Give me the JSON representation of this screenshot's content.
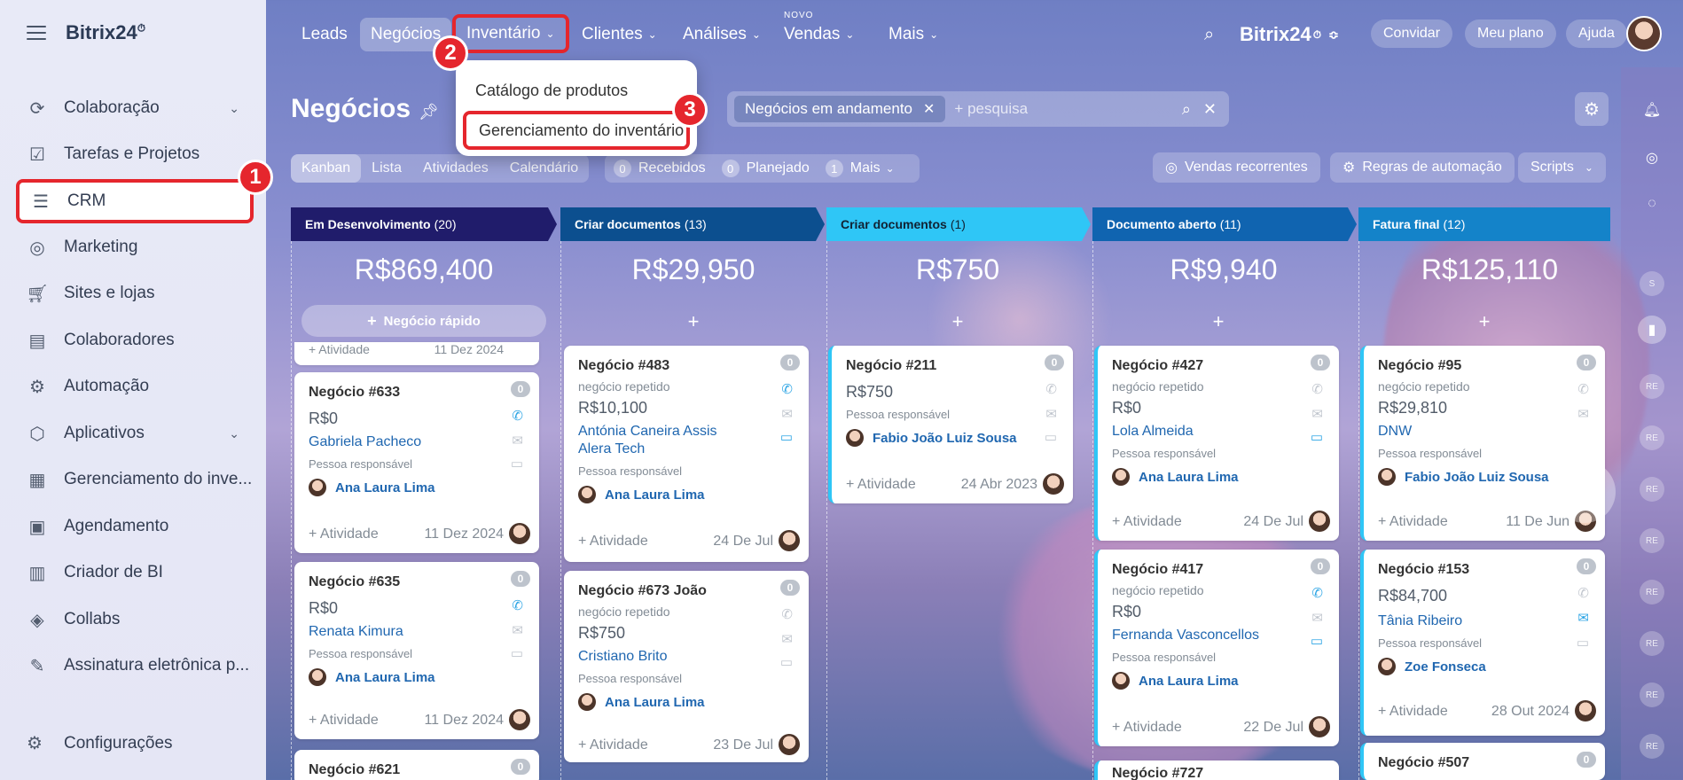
{
  "app": {
    "logo": "Bitrix24",
    "logo_mark": "⏱"
  },
  "sidebar": {
    "items": [
      {
        "label": "Colaboração",
        "icon": "collab-icon",
        "chevron": true
      },
      {
        "label": "Tarefas e Projetos",
        "icon": "tasks-icon"
      },
      {
        "label": "CRM",
        "icon": "crm-icon",
        "active": true
      },
      {
        "label": "Marketing",
        "icon": "marketing-icon"
      },
      {
        "label": "Sites e lojas",
        "icon": "cart-icon"
      },
      {
        "label": "Colaboradores",
        "icon": "employees-icon"
      },
      {
        "label": "Automação",
        "icon": "robot-icon"
      },
      {
        "label": "Aplicativos",
        "icon": "cube-icon",
        "chevron": true
      },
      {
        "label": "Gerenciamento do inve...",
        "icon": "inventory-icon"
      },
      {
        "label": "Agendamento",
        "icon": "calendar-icon"
      },
      {
        "label": "Criador de BI",
        "icon": "chart-icon"
      },
      {
        "label": "Collabs",
        "icon": "collabs-icon"
      },
      {
        "label": "Assinatura eletrônica p...",
        "icon": "sign-icon"
      }
    ],
    "config": "Configurações"
  },
  "topnav": {
    "items": [
      "Leads",
      "Negócios",
      "Inventário",
      "Clientes",
      "Análises",
      "Vendas",
      "Mais"
    ],
    "novo": "NOVO",
    "brand": "Bitrix24",
    "invite": "Convidar",
    "plan": "Meu plano",
    "help": "Ajuda"
  },
  "dropdown": {
    "item1": "Catálogo de produtos",
    "item2": "Gerenciamento do inventário"
  },
  "badges": [
    "1",
    "2",
    "3"
  ],
  "page": {
    "title": "Negócios",
    "filter_chip": "Negócios em andamento",
    "search_placeholder": "+ pesquisa"
  },
  "views": [
    "Kanban",
    "Lista",
    "Atividades",
    "Calendário"
  ],
  "counters": [
    {
      "n": "0",
      "label": "Recebidos"
    },
    {
      "n": "0",
      "label": "Planejado"
    },
    {
      "n": "1",
      "label": "Mais"
    }
  ],
  "tools": {
    "recurring": "Vendas recorrentes",
    "rules": "Regras de automação",
    "scripts": "Scripts"
  },
  "columns": [
    {
      "title": "Em Desenvolvimento",
      "count": "(20)",
      "sum": "R$869,400",
      "color": "#201c6b"
    },
    {
      "title": "Criar documentos",
      "count": "(13)",
      "sum": "R$29,950",
      "color": "#0c4f8f"
    },
    {
      "title": "Criar documentos",
      "count": "(1)",
      "sum": "R$750",
      "color": "#2fc6f6"
    },
    {
      "title": "Documento aberto",
      "count": "(11)",
      "sum": "R$9,940",
      "color": "#1064b0"
    },
    {
      "title": "Fatura final",
      "count": "(12)",
      "sum": "R$125,110",
      "color": "#1483c9"
    }
  ],
  "quick_deal": "Negócio rápido",
  "cards": {
    "c1_top": {
      "act": "+ Atividade",
      "date": "11 Dez 2024"
    },
    "c633": {
      "title": "Negócio #633",
      "count": "0",
      "amount": "R$0",
      "client": "Gabriela Pacheco",
      "resp": "Pessoa responsável",
      "person": "Ana Laura Lima",
      "act": "+ Atividade",
      "date": "11 Dez 2024"
    },
    "c635": {
      "title": "Negócio #635",
      "count": "0",
      "amount": "R$0",
      "client": "Renata Kimura",
      "resp": "Pessoa responsável",
      "person": "Ana Laura Lima",
      "act": "+ Atividade",
      "date": "11 Dez 2024"
    },
    "c621": {
      "title": "Negócio #621",
      "count": "0"
    },
    "c483": {
      "title": "Negócio #483",
      "count": "0",
      "sub": "negócio repetido",
      "amount": "R$10,100",
      "client": "Antónia Caneira Assis",
      "client2": "Alera Tech",
      "resp": "Pessoa responsável",
      "person": "Ana Laura Lima",
      "act": "+ Atividade",
      "date": "24 De Jul"
    },
    "c673": {
      "title": "Negócio #673 João",
      "count": "0",
      "sub": "negócio repetido",
      "amount": "R$750",
      "client": "Cristiano Brito",
      "resp": "Pessoa responsável",
      "person": "Ana Laura Lima",
      "act": "+ Atividade",
      "date": "23 De Jul"
    },
    "c211": {
      "title": "Negócio #211",
      "count": "0",
      "amount": "R$750",
      "resp": "Pessoa responsável",
      "person": "Fabio João Luiz Sousa",
      "act": "+ Atividade",
      "date": "24 Abr 2023"
    },
    "c427": {
      "title": "Negócio #427",
      "count": "0",
      "sub": "negócio repetido",
      "amount": "R$0",
      "client": "Lola Almeida",
      "resp": "Pessoa responsável",
      "person": "Ana Laura Lima",
      "act": "+ Atividade",
      "date": "24 De Jul"
    },
    "c417": {
      "title": "Negócio #417",
      "count": "0",
      "sub": "negócio repetido",
      "amount": "R$0",
      "client": "Fernanda Vasconcellos",
      "resp": "Pessoa responsável",
      "person": "Ana Laura Lima",
      "act": "+ Atividade",
      "date": "22 De Jul"
    },
    "c727": {
      "title": "Negócio #727"
    },
    "c95": {
      "title": "Negócio #95",
      "count": "0",
      "sub": "negócio repetido",
      "amount": "R$29,810",
      "client": "DNW",
      "resp": "Pessoa responsável",
      "person": "Fabio João Luiz Sousa",
      "act": "+ Atividade",
      "date": "11 De Jun"
    },
    "c153": {
      "title": "Negócio #153",
      "count": "0",
      "amount": "R$84,700",
      "client": "Tânia Ribeiro",
      "resp": "Pessoa responsável",
      "person": "Zoe Fonseca",
      "act": "+ Atividade",
      "date": "28 Out 2024"
    },
    "c507": {
      "title": "Negócio #507",
      "count": "0"
    }
  },
  "rail": {
    "re": "RE",
    "s": "S"
  }
}
